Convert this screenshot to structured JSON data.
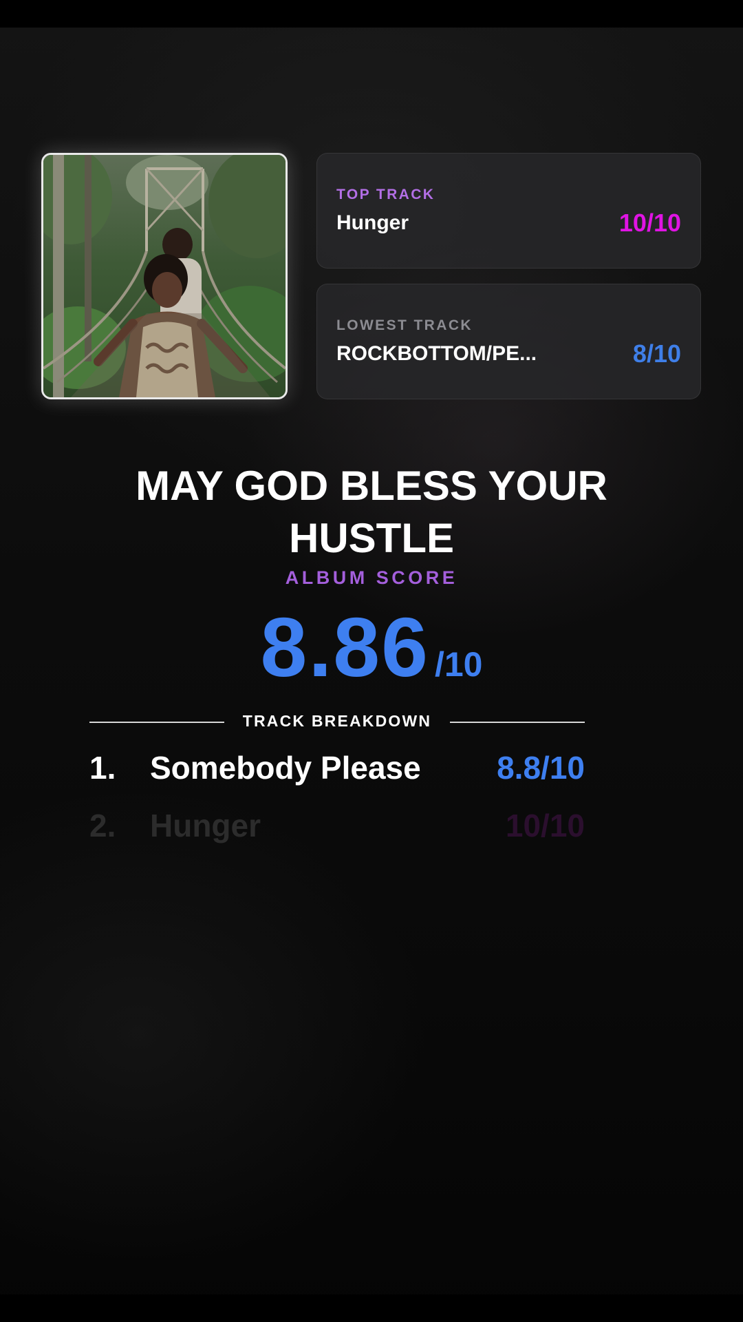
{
  "album": {
    "cover_alt": "album-cover-photo",
    "title": "MAY GOD BLESS YOUR HUSTLE",
    "score_label": "ALBUM SCORE",
    "score_value": "8.86",
    "score_denominator": "/10"
  },
  "top_track": {
    "label": "TOP TRACK",
    "name": "Hunger",
    "score": "10/10"
  },
  "lowest_track": {
    "label": "LOWEST TRACK",
    "name": "ROCKBOTTOM/PE...",
    "score": "8/10"
  },
  "breakdown": {
    "heading": "TRACK BREAKDOWN",
    "tracks": [
      {
        "number": "1.",
        "title": "Somebody Please",
        "score": "8.8/10"
      },
      {
        "number": "2.",
        "title": "Hunger",
        "score": "10/10"
      }
    ]
  },
  "colors": {
    "accent_blue": "#3e7ff0",
    "accent_magenta": "#e014e4",
    "accent_purple": "#a45fdc"
  }
}
